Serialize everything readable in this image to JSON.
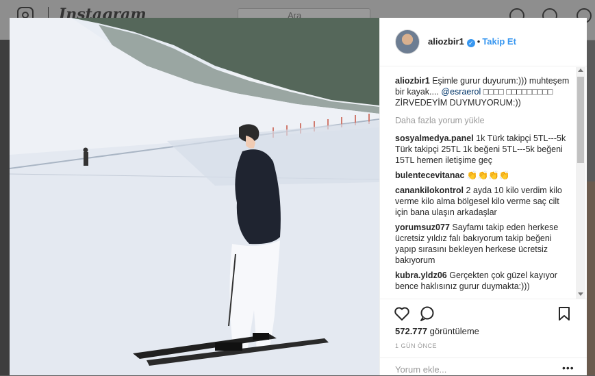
{
  "background": {
    "wordmark": "Instagram",
    "search_placeholder": "Ara"
  },
  "post": {
    "username": "aliozbir1",
    "verified_glyph": "✓",
    "dot": "•",
    "follow_label": "Takip Et",
    "caption": {
      "username": "aliozbir1",
      "text_before": "Eşimle gurur duyurum:))) muhteşem bir kayak.... ",
      "mention": "@esraerol",
      "text_after": " □□□□ □□□□□□□□□ ZİRVEDEYİM DUYMUYORUM:))"
    },
    "load_more": "Daha fazla yorum yükle",
    "comments": [
      {
        "user": "sosyalmedya.panel",
        "text": "1k Türk takipçi 5TL---5k Türk takipçi 25TL 1k beğeni 5TL---5k beğeni 15TL hemen iletişime geç"
      },
      {
        "user": "bulentecevitanac",
        "text": "👏👏👏👏"
      },
      {
        "user": "canankilokontrol",
        "text": "2 ayda 10 kilo verdim kilo verme kilo alma bölgesel kilo verme saç cilt için bana ulaşın arkadaşlar"
      },
      {
        "user": "yorumsuz077",
        "text": "Sayfamı takip eden herkese ücretsiz yıldız falı bakıyorum takip beğeni yapıp sırasını bekleyen herkese ücretsiz bakıyorum"
      },
      {
        "user": "kubra.yldz06",
        "text": "Gerçekten çok güzel kayıyor bence haklısınız gurur duymakta:)))"
      }
    ],
    "views_count": "572.777",
    "views_label": "görüntüleme",
    "time": "1 GÜN ÖNCE",
    "comment_placeholder": "Yorum ekle...",
    "more_label": "•••"
  },
  "icons": {
    "like": "heart-icon",
    "comment": "speech-bubble-icon",
    "save": "bookmark-icon"
  },
  "colors": {
    "link": "#3897f0",
    "text": "#262626",
    "muted": "#999999",
    "mention": "#003569"
  }
}
